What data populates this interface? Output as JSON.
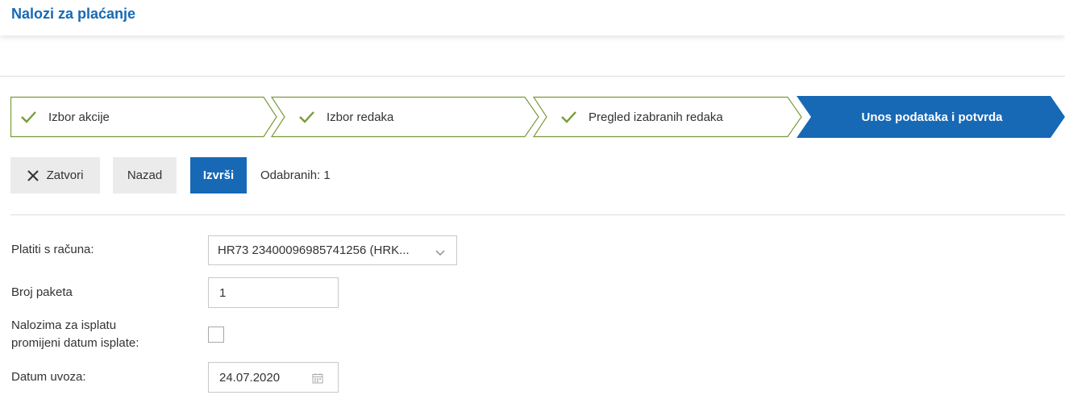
{
  "header": {
    "title": "Nalozi za plaćanje"
  },
  "wizard": {
    "steps": [
      {
        "label": "Izbor akcije",
        "status": "done"
      },
      {
        "label": "Izbor redaka",
        "status": "done"
      },
      {
        "label": "Pregled izabranih redaka",
        "status": "done"
      },
      {
        "label": "Unos podataka i potvrda",
        "status": "active"
      }
    ],
    "colors": {
      "done_border": "#7a9a3a",
      "check": "#7a9a3a",
      "active_bg": "#1769b5"
    }
  },
  "toolbar": {
    "close_label": "Zatvori",
    "back_label": "Nazad",
    "execute_label": "Izvrši",
    "selected_label": "Odabranih: 1"
  },
  "form": {
    "account_label": "Platiti s računa:",
    "account_value": "HR73 23400096985741256 (HRK...",
    "package_label": "Broj paketa",
    "package_value": "1",
    "change_date_label_line1": "Nalozima za isplatu",
    "change_date_label_line2": "promijeni datum isplate:",
    "change_date_checked": false,
    "import_date_label": "Datum uvoza:",
    "import_date_value": "24.07.2020"
  },
  "icons": {
    "check": "check-icon",
    "close": "close-icon",
    "dropdown": "chevron-down-icon",
    "calendar": "calendar-icon"
  }
}
